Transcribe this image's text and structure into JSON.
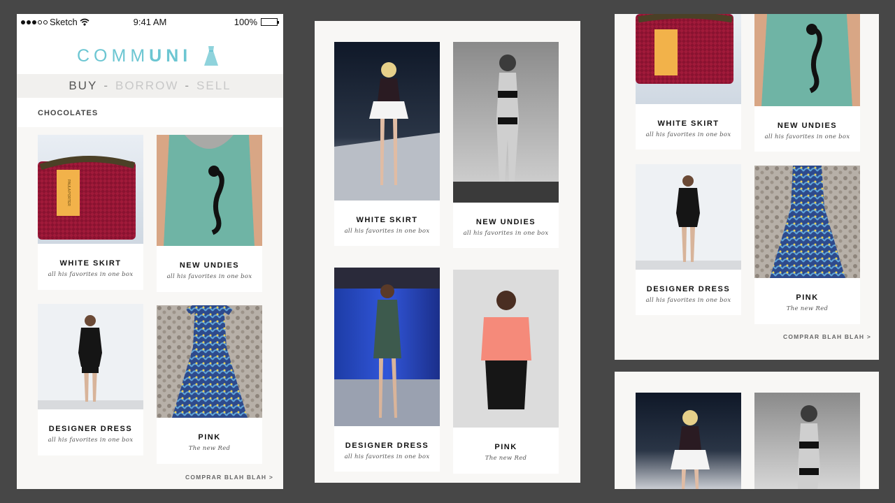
{
  "status": {
    "carrier": "Sketch",
    "time": "9:41 AM",
    "battery": "100%"
  },
  "brand": {
    "logo_light": "COMM",
    "logo_bold": "UNI"
  },
  "nav": {
    "buy": "BUY",
    "sep": "-",
    "borrow": "BORROW",
    "sell": "SELL"
  },
  "section": {
    "title": "CHOCOLATES"
  },
  "products": [
    {
      "name": "WHITE SKIRT",
      "desc": "all his favorites in one box"
    },
    {
      "name": "NEW UNDIES",
      "desc": "all his favorites in one box"
    },
    {
      "name": "DESIGNER DRESS",
      "desc": "all his favorites in one box"
    },
    {
      "name": "PINK",
      "desc": "The new Red"
    }
  ],
  "tag_text": "PAULA PORTER",
  "more_link": "COMPRAR BLAH BLAH >",
  "colors": {
    "background": "#474747",
    "artboard": "#f8f7f5",
    "logo": "#6cc6d2",
    "nav_active": "#555555",
    "nav_inactive": "#c8c8c8"
  },
  "icons": [
    "wifi-icon",
    "battery-icon",
    "dress-logo-icon",
    "signal-dots-icon"
  ]
}
